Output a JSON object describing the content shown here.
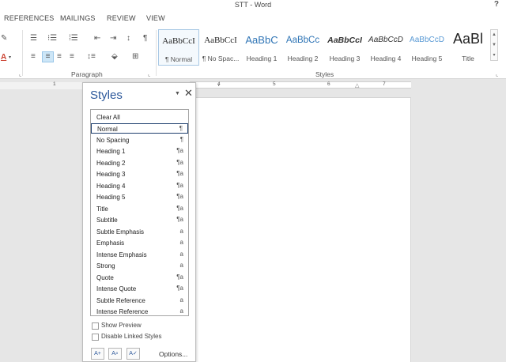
{
  "window": {
    "title": "STT - Word",
    "help_label": "?"
  },
  "tabs": [
    "REFERENCES",
    "MAILINGS",
    "REVIEW",
    "VIEW"
  ],
  "ribbon": {
    "paragraph_group_label": "Paragraph",
    "styles_group_label": "Styles",
    "launcher_glyph": "⌞",
    "icons": {
      "bullets": "☰",
      "numbering": "⁝☰",
      "multilevel": "⁞☰",
      "decrease_indent": "⇤",
      "increase_indent": "⇥",
      "sort": "↕",
      "show_marks": "¶",
      "align_left": "≡",
      "center": "≡",
      "align_right": "≡",
      "justify": "≡",
      "line_spacing": "↕≡",
      "shading": "⬙",
      "borders": "⊞",
      "format_painter": "✎",
      "font_color": "A"
    },
    "gallery": [
      {
        "preview": "AaBbCcI",
        "name": "¶ Normal",
        "selected": true
      },
      {
        "preview": "AaBbCcI",
        "name": "¶ No Spac...",
        "selected": false
      },
      {
        "preview": "AaBbC",
        "name": "Heading 1",
        "selected": false
      },
      {
        "preview": "AaBbCc",
        "name": "Heading 2",
        "selected": false
      },
      {
        "preview": "AaBbCcI",
        "name": "Heading 3",
        "selected": false
      },
      {
        "preview": "AaBbCcD",
        "name": "Heading 4",
        "selected": false
      },
      {
        "preview": "AaBbCcD",
        "name": "Heading 5",
        "selected": false
      },
      {
        "preview": "AaBl",
        "name": "Title",
        "selected": false
      }
    ],
    "gallery_scroll": [
      "▲",
      "▼",
      "▾"
    ]
  },
  "ruler": {
    "numbers": [
      "1",
      "4",
      "5",
      "6",
      "7"
    ],
    "tab_glyph": "△"
  },
  "styles_pane": {
    "title": "Styles",
    "menu_glyph": "▼",
    "close_glyph": "✕",
    "items": [
      {
        "label": "Clear All",
        "mark": "",
        "selected": false
      },
      {
        "label": "Normal",
        "mark": "¶",
        "selected": true
      },
      {
        "label": "No Spacing",
        "mark": "¶",
        "selected": false
      },
      {
        "label": "Heading 1",
        "mark": "¶a",
        "selected": false
      },
      {
        "label": "Heading 2",
        "mark": "¶a",
        "selected": false
      },
      {
        "label": "Heading 3",
        "mark": "¶a",
        "selected": false
      },
      {
        "label": "Heading 4",
        "mark": "¶a",
        "selected": false
      },
      {
        "label": "Heading 5",
        "mark": "¶a",
        "selected": false
      },
      {
        "label": "Title",
        "mark": "¶a",
        "selected": false
      },
      {
        "label": "Subtitle",
        "mark": "¶a",
        "selected": false
      },
      {
        "label": "Subtle Emphasis",
        "mark": "a",
        "selected": false
      },
      {
        "label": "Emphasis",
        "mark": "a",
        "selected": false
      },
      {
        "label": "Intense Emphasis",
        "mark": "a",
        "selected": false
      },
      {
        "label": "Strong",
        "mark": "a",
        "selected": false
      },
      {
        "label": "Quote",
        "mark": "¶a",
        "selected": false
      },
      {
        "label": "Intense Quote",
        "mark": "¶a",
        "selected": false
      },
      {
        "label": "Subtle Reference",
        "mark": "a",
        "selected": false
      },
      {
        "label": "Intense Reference",
        "mark": "a",
        "selected": false
      }
    ],
    "show_preview_label": "Show Preview",
    "disable_linked_label": "Disable Linked Styles",
    "new_style_glyph": "A+",
    "inspector_glyph": "A⌕",
    "manage_glyph": "A✓",
    "options_label": "Options..."
  }
}
